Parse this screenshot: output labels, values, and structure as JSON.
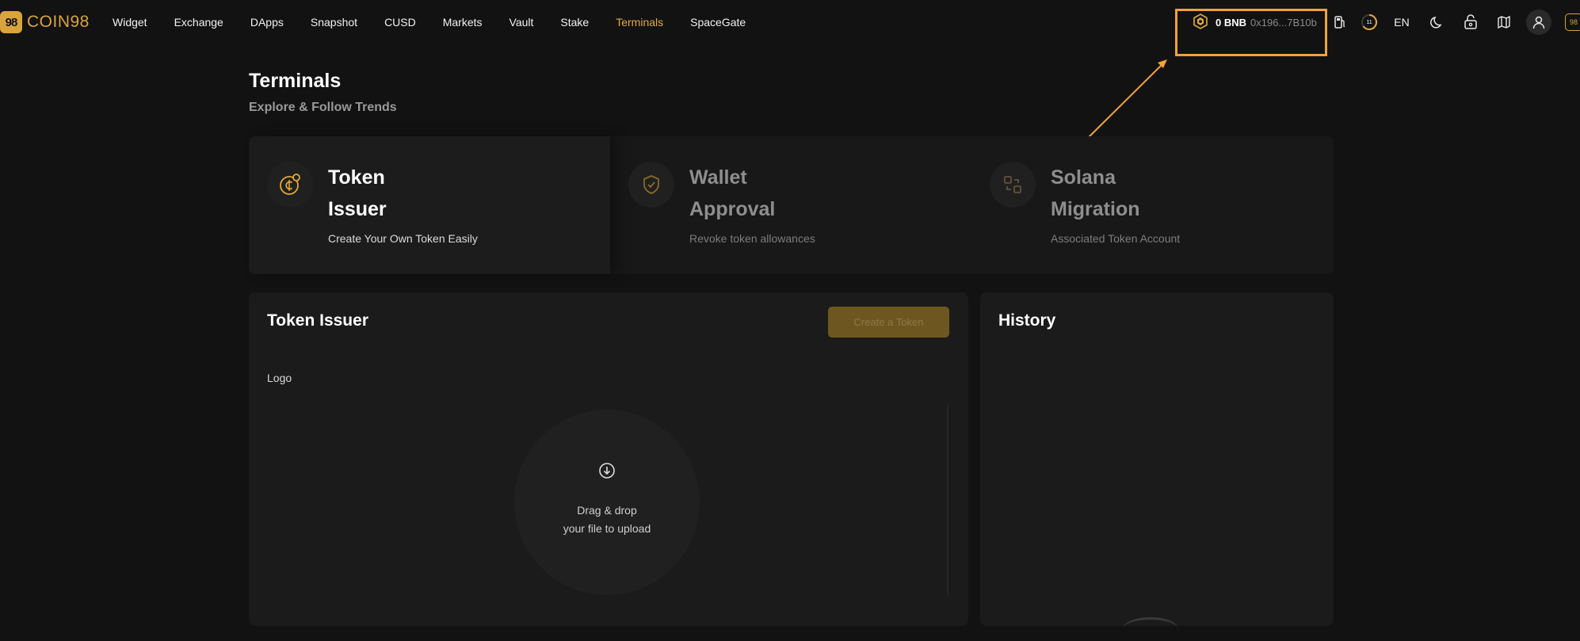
{
  "brand": {
    "mark": "98",
    "name": "COIN98"
  },
  "nav": {
    "items": [
      {
        "label": "Widget",
        "active": false
      },
      {
        "label": "Exchange",
        "active": false
      },
      {
        "label": "DApps",
        "active": false
      },
      {
        "label": "Snapshot",
        "active": false
      },
      {
        "label": "CUSD",
        "active": false
      },
      {
        "label": "Markets",
        "active": false
      },
      {
        "label": "Vault",
        "active": false
      },
      {
        "label": "Stake",
        "active": false
      },
      {
        "label": "Terminals",
        "active": true
      },
      {
        "label": "SpaceGate",
        "active": false
      }
    ]
  },
  "wallet": {
    "balance": "0 BNB",
    "address": "0x196...7B10b",
    "icon": "bnb-icon"
  },
  "header_icons": {
    "gas_icon": "gas-station-icon",
    "notification_count": "11",
    "language": "EN",
    "theme_icon": "moon-icon",
    "lock_icon": "lock-icon",
    "map_icon": "map-icon",
    "user_icon": "user-icon",
    "extension_mark": "98"
  },
  "page": {
    "title": "Terminals",
    "subtitle": "Explore & Follow Trends"
  },
  "cards": [
    {
      "title_line1": "Token",
      "title_line2": "Issuer",
      "description": "Create Your Own Token Easily",
      "icon": "coin-plus-icon",
      "active": true
    },
    {
      "title_line1": "Wallet",
      "title_line2": "Approval",
      "description": "Revoke token allowances",
      "icon": "shield-check-icon",
      "active": false
    },
    {
      "title_line1": "Solana",
      "title_line2": "Migration",
      "description": "Associated Token Account",
      "icon": "migration-icon",
      "active": false
    }
  ],
  "issuer": {
    "title": "Token Issuer",
    "create_button": "Create a Token",
    "logo_label": "Logo",
    "drop_line1": "Drag & drop",
    "drop_line2": "your file to upload"
  },
  "history": {
    "title": "History"
  },
  "colors": {
    "accent": "#e3aa3c",
    "background": "#121212",
    "panel": "#1b1b1b",
    "highlight_box": "#f2a23a"
  }
}
